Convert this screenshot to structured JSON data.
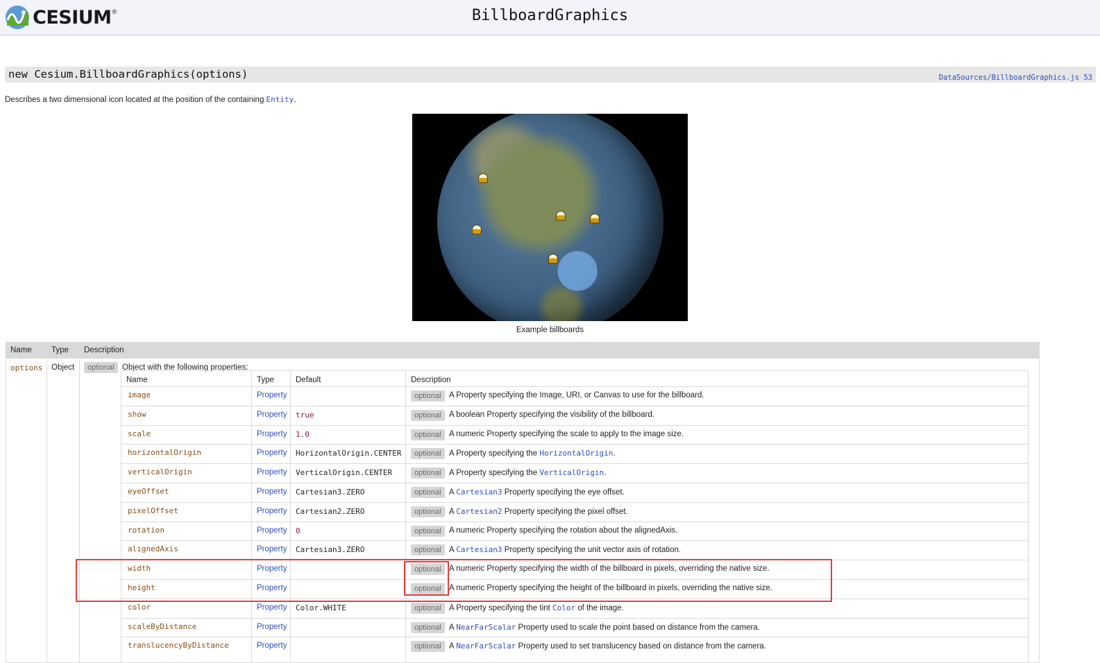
{
  "header": {
    "logo_text": "CESIUM",
    "logo_reg": "®",
    "title": "BillboardGraphics"
  },
  "signature": {
    "text": "new Cesium.BillboardGraphics(options)",
    "source_link": "DataSources/BillboardGraphics.js 53"
  },
  "intro": {
    "before": "Describes a two dimensional icon located at the position of the containing",
    "link": "Entity",
    "after": "."
  },
  "figure": {
    "caption": "Example billboards"
  },
  "params_table": {
    "headers": [
      "Name",
      "Type",
      "Description"
    ],
    "row": {
      "name": "options",
      "type": "Object",
      "badge": "optional",
      "description": "Object with the following properties:"
    }
  },
  "options_table": {
    "headers": [
      "Name",
      "Type",
      "Default",
      "Description"
    ],
    "rows": [
      {
        "name": "image",
        "type": "Property",
        "default": "",
        "badge": "optional",
        "desc": "A Property specifying the Image, URI, or Canvas to use for the billboard."
      },
      {
        "name": "show",
        "type": "Property",
        "default": "true",
        "badge": "optional",
        "desc": "A boolean Property specifying the visibility of the billboard."
      },
      {
        "name": "scale",
        "type": "Property",
        "default": "1.0",
        "badge": "optional",
        "desc": "A numeric Property specifying the scale to apply to the image size."
      },
      {
        "name": "horizontalOrigin",
        "type": "Property",
        "default": "HorizontalOrigin.CENTER",
        "badge": "optional",
        "desc_before": "A Property specifying the",
        "desc_link": "HorizontalOrigin",
        "desc_after": "."
      },
      {
        "name": "verticalOrigin",
        "type": "Property",
        "default": "VerticalOrigin.CENTER",
        "badge": "optional",
        "desc_before": "A Property specifying the",
        "desc_link": "VerticalOrigin",
        "desc_after": "."
      },
      {
        "name": "eyeOffset",
        "type": "Property",
        "default": "Cartesian3.ZERO",
        "badge": "optional",
        "desc_before": "A",
        "desc_link": "Cartesian3",
        "desc_after": "Property specifying the eye offset."
      },
      {
        "name": "pixelOffset",
        "type": "Property",
        "default": "Cartesian2.ZERO",
        "badge": "optional",
        "desc_before": "A",
        "desc_link": "Cartesian2",
        "desc_after": "Property specifying the pixel offset."
      },
      {
        "name": "rotation",
        "type": "Property",
        "default": "0",
        "badge": "optional",
        "desc": "A numeric Property specifying the rotation about the alignedAxis."
      },
      {
        "name": "alignedAxis",
        "type": "Property",
        "default": "Cartesian3.ZERO",
        "badge": "optional",
        "desc_before": "A",
        "desc_link": "Cartesian3",
        "desc_after": "Property specifying the unit vector axis of rotation."
      },
      {
        "name": "width",
        "type": "Property",
        "default": "",
        "badge": "optional",
        "desc": "A numeric Property specifying the width of the billboard in pixels, overriding the native size."
      },
      {
        "name": "height",
        "type": "Property",
        "default": "",
        "badge": "optional",
        "desc": "A numeric Property specifying the height of the billboard in pixels, overriding the native size."
      },
      {
        "name": "color",
        "type": "Property",
        "default": "Color.WHITE",
        "badge": "optional",
        "desc_before": "A Property specifying the tint",
        "desc_link": "Color",
        "desc_after": "of the image."
      },
      {
        "name": "scaleByDistance",
        "type": "Property",
        "default": "",
        "badge": "optional",
        "desc_before": "A",
        "desc_link": "NearFarScalar",
        "desc_after": "Property used to scale the point based on distance from the camera."
      },
      {
        "name": "translucencyByDistance",
        "type": "Property",
        "default": "",
        "badge": "optional",
        "desc_before": "A",
        "desc_link": "NearFarScalar",
        "desc_after": "Property used to set translucency based on distance from the camera."
      }
    ]
  },
  "colors": {
    "link": "#2c4fc0",
    "param_name": "#8a4d12",
    "highlight": "#e04040"
  }
}
